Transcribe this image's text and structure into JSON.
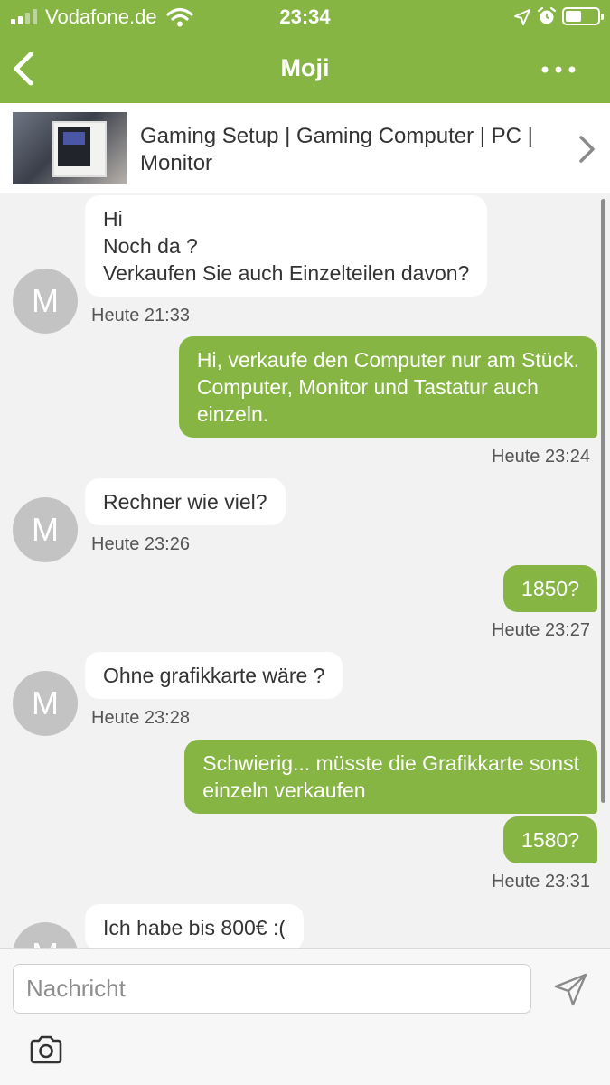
{
  "status": {
    "carrier": "Vodafone.de",
    "time": "23:34"
  },
  "nav": {
    "title": "Moji"
  },
  "listing": {
    "title": "Gaming Setup | Gaming Computer | PC | Monitor"
  },
  "avatar_letter": "M",
  "messages": [
    {
      "dir": "in",
      "text": "Hi\nNoch da ?\nVerkaufen Sie auch Einzelteilen davon?",
      "time": "Heute 21:33"
    },
    {
      "dir": "out",
      "text": "Hi, verkaufe den Computer nur am Stück.\nComputer, Monitor und Tastatur auch\neinzeln.",
      "time": "Heute 23:24"
    },
    {
      "dir": "in",
      "text": "Rechner wie viel?",
      "time": "Heute 23:26"
    },
    {
      "dir": "out",
      "text": "1850?",
      "time": "Heute 23:27"
    },
    {
      "dir": "in",
      "text": "Ohne grafikkarte wäre ?",
      "time": "Heute 23:28"
    },
    {
      "dir": "out",
      "text": "Schwierig... müsste die Grafikkarte sonst\neinzeln verkaufen",
      "time": ""
    },
    {
      "dir": "out",
      "text": "1580?",
      "time": "Heute 23:31"
    },
    {
      "dir": "in",
      "text": "Ich habe bis 800€ :(",
      "time": ""
    }
  ],
  "composer": {
    "placeholder": "Nachricht"
  },
  "icons": {
    "back": "chevron-left-icon",
    "more": "more-dots-icon",
    "listing_chevron": "chevron-right-icon",
    "send": "send-icon",
    "camera": "camera-icon"
  },
  "colors": {
    "brand": "#86b544",
    "bubble_in": "#ffffff",
    "background": "#f2f2f2"
  }
}
